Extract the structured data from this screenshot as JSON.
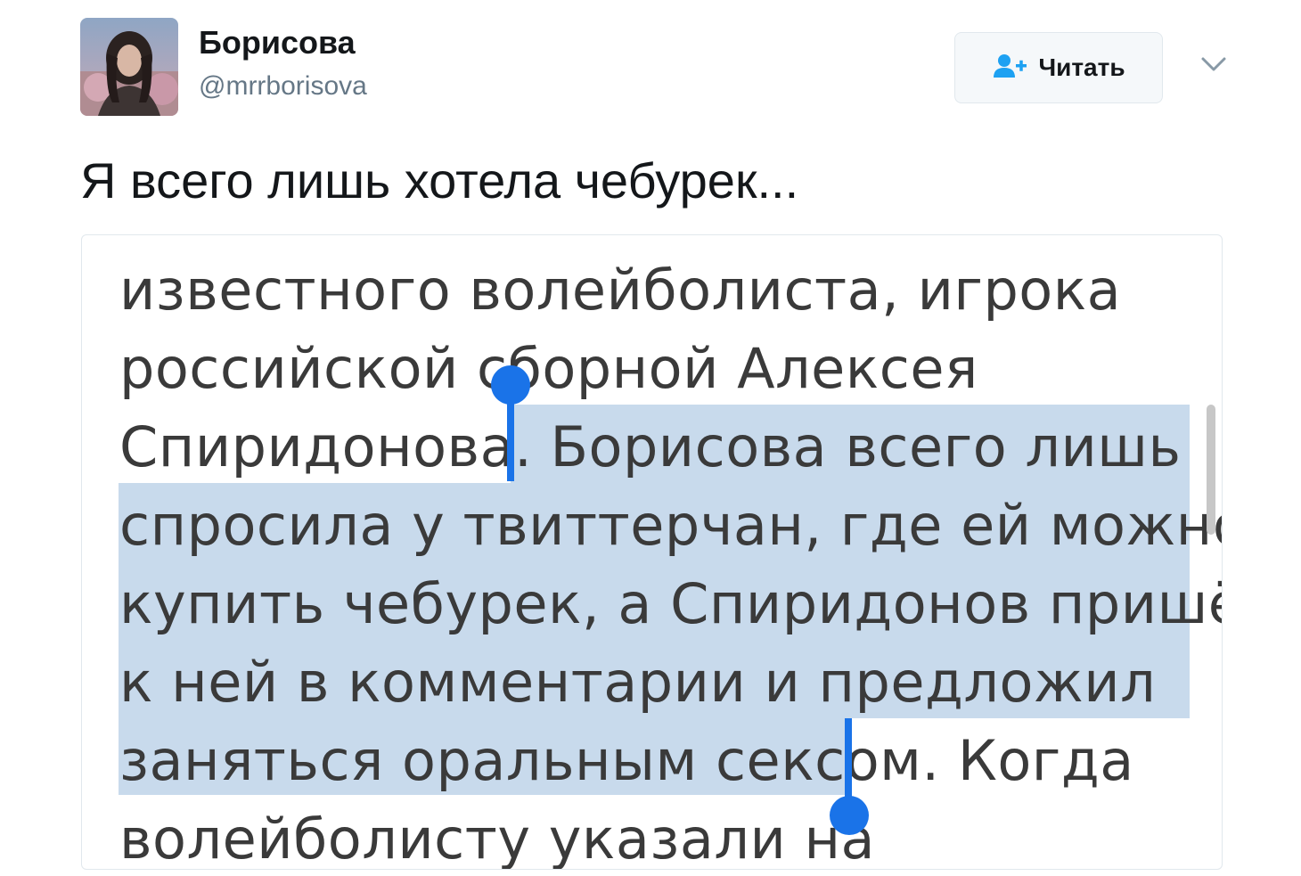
{
  "user": {
    "name": "Борисова",
    "handle": "@mrrborisova"
  },
  "follow_button": {
    "label": "Читать",
    "icon": "add-user-icon"
  },
  "menu": {
    "icon": "chevron-down-icon"
  },
  "tweet": {
    "text": "Я всего лишь хотела чебурек..."
  },
  "media": {
    "lines": [
      "известного волейболиста, игрока",
      "российской сборной Алексея",
      "Спиридонова. Борисова всего лишь",
      "спросила у твиттерчан, где ей можно",
      "купить чебурек, а Спиридонов пришёл",
      "к ней в комментарии и предложил",
      "заняться оральным сексом. Когда",
      "волейболисту указали на"
    ],
    "selected_text": "Борисова всего лишь спросила у твиттерчан, где ей можно купить чебурек, а Спиридонов пришёл к ней в комментарии и предложил заняться оральным сексом",
    "selection_color": "#c8daec",
    "handle_color": "#1a73e8"
  },
  "colors": {
    "name": "#14171a",
    "handle": "#657786",
    "follow_icon": "#1da1f2"
  }
}
